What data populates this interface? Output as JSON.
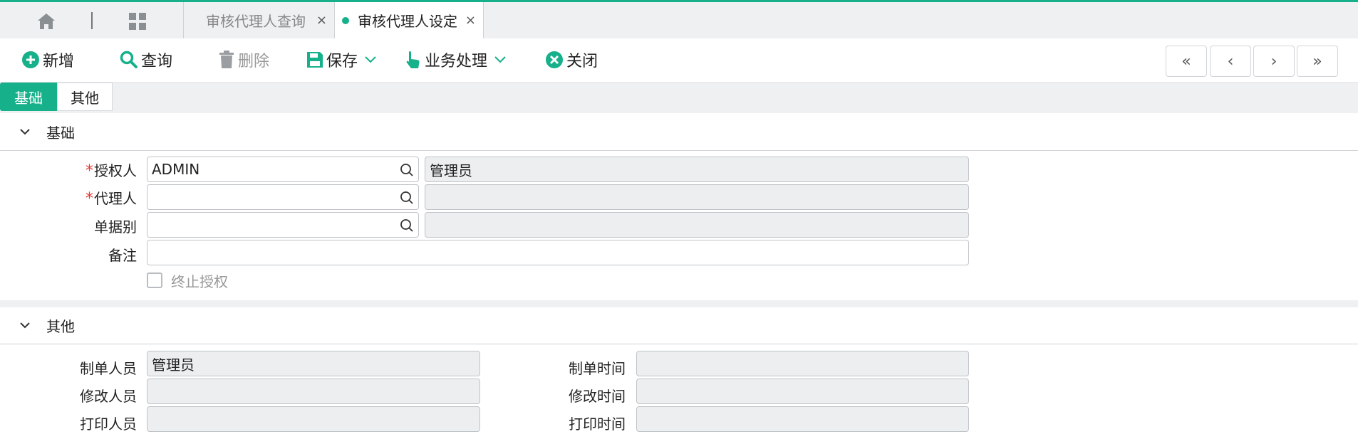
{
  "tabs": {
    "tab1_label": "审核代理人查询",
    "tab2_label": "审核代理人设定",
    "close_glyph": "×",
    "accent": "#16b08a"
  },
  "toolbar": {
    "add_label": "新增",
    "query_label": "查询",
    "delete_label": "删除",
    "save_label": "保存",
    "biz_label": "业务处理",
    "close_label": "关闭",
    "nav_first": "«",
    "nav_prev": "‹",
    "nav_next": "›",
    "nav_last": "»"
  },
  "section_tabs": {
    "basic": "基础",
    "other": "其他"
  },
  "basic": {
    "title": "基础",
    "grantor_label": "授权人",
    "grantor_code": "ADMIN",
    "grantor_name": "管理员",
    "agent_label": "代理人",
    "agent_code": "",
    "agent_name": "",
    "doctype_label": "单据别",
    "doctype_code": "",
    "doctype_name": "",
    "remark_label": "备注",
    "remark": "",
    "terminate_label": "终止授权",
    "required_mark": "*"
  },
  "other": {
    "title": "其他",
    "creator_label": "制单人员",
    "creator": "管理员",
    "create_time_label": "制单时间",
    "create_time": "",
    "modifier_label": "修改人员",
    "modifier": "",
    "modify_time_label": "修改时间",
    "modify_time": "",
    "printer_label": "打印人员",
    "printer": "",
    "print_time_label": "打印时间",
    "print_time": ""
  }
}
